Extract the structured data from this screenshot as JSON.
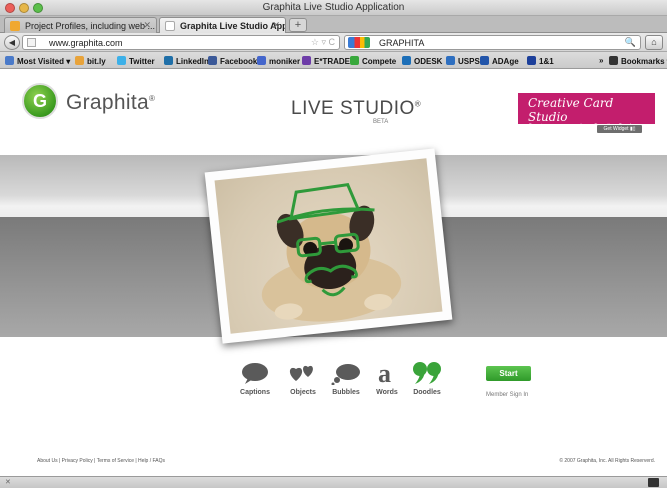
{
  "window": {
    "title": "Graphita Live Studio Application"
  },
  "tabs": [
    {
      "label": "Project Profiles, including web ...",
      "close": "✕"
    },
    {
      "label": "Graphita Live Studio Application",
      "close": "✕"
    }
  ],
  "newtab_label": "+",
  "nav": {
    "back": "◀",
    "url": "www.graphita.com",
    "url_right": "☆ ▿ C",
    "search_value": "GRAPHITA",
    "search_go": "🔍",
    "home": "⌂"
  },
  "bookmarks": {
    "items": [
      {
        "label": "Most Visited ▾",
        "color": "#4a7ac9"
      },
      {
        "label": "bit.ly",
        "color": "#e8a33a"
      },
      {
        "label": "Twitter",
        "color": "#3cb0e8"
      },
      {
        "label": "LinkedIn",
        "color": "#1f6fa8"
      },
      {
        "label": "Facebook",
        "color": "#3b5998"
      },
      {
        "label": "moniker",
        "color": "#4466cc"
      },
      {
        "label": "E*TRADE",
        "color": "#6d3ca8"
      },
      {
        "label": "Compete",
        "color": "#38a83c"
      },
      {
        "label": "ODESK",
        "color": "#1d6fb8"
      },
      {
        "label": "USPS",
        "color": "#2e6fc0"
      },
      {
        "label": "ADAge",
        "color": "#2255aa"
      },
      {
        "label": "1&1",
        "color": "#1c3f9a"
      }
    ],
    "overflow": "»",
    "menu": "Bookmarks ▾"
  },
  "header": {
    "logo_mark": "G",
    "logo_text": "Graphita",
    "logo_reg": "®",
    "live_studio": "LIVE STUDIO",
    "live_studio_reg": "®",
    "beta": "BETA",
    "promo_title": "Creative Card Studio",
    "promo_sub": "Create your own unique Greeting Cards",
    "get_widget": "Get Widget ▮▯"
  },
  "tools": [
    {
      "label": "Captions",
      "icon": "speech-bubble-icon"
    },
    {
      "label": "Objects",
      "icon": "hearts-icon"
    },
    {
      "label": "Bubbles",
      "icon": "thought-bubble-icon"
    },
    {
      "label": "Words",
      "icon": "letter-a-icon"
    },
    {
      "label": "Doodles",
      "icon": "quote-marks-icon"
    }
  ],
  "start_label": "Start",
  "member_signin": "Member Sign In",
  "footer": {
    "links": "About Us  |  Privacy Policy  |  Terms of Service  |  Help / FAQs",
    "copyright": "© 2007 Graphita, Inc.  All Rights Reserverd."
  },
  "status": {
    "close": "✕"
  },
  "colors": {
    "accent_green": "#2f9a2a",
    "doodle_green": "#2f9a3a",
    "promo_pink": "#c31e6d"
  }
}
